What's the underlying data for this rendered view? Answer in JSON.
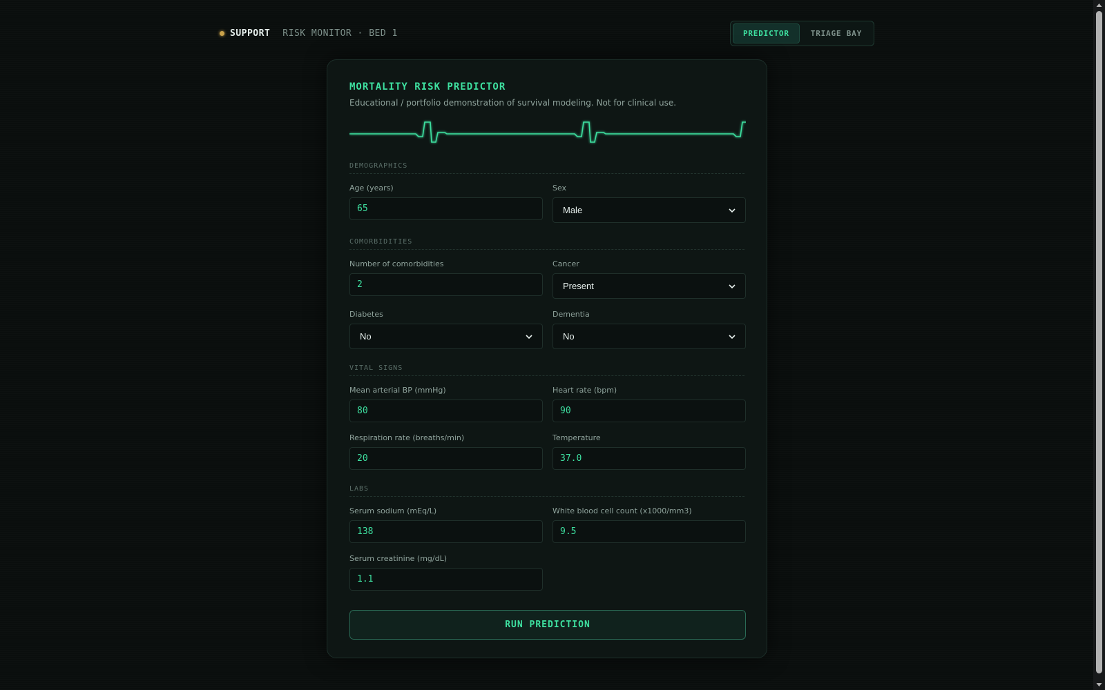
{
  "header": {
    "brand": "SUPPORT",
    "subtitle": "RISK MONITOR · BED 1",
    "tabs": [
      {
        "label": "PREDICTOR",
        "active": true
      },
      {
        "label": "TRIAGE BAY",
        "active": false
      }
    ]
  },
  "card": {
    "title": "MORTALITY RISK PREDICTOR",
    "subtitle": "Educational / portfolio demonstration of survival modeling. Not for clinical use."
  },
  "sections": {
    "demographics": "DEMOGRAPHICS",
    "comorbidities": "COMORBIDITIES",
    "vitals": "VITAL SIGNS",
    "labs": "LABS"
  },
  "fields": {
    "age": {
      "label": "Age (years)",
      "value": "65"
    },
    "sex": {
      "label": "Sex",
      "value": "Male"
    },
    "num_comorbidities": {
      "label": "Number of comorbidities",
      "value": "2"
    },
    "cancer": {
      "label": "Cancer",
      "value": "Present"
    },
    "diabetes": {
      "label": "Diabetes",
      "value": "No"
    },
    "dementia": {
      "label": "Dementia",
      "value": "No"
    },
    "mean_bp": {
      "label": "Mean arterial BP (mmHg)",
      "value": "80"
    },
    "heart_rate": {
      "label": "Heart rate (bpm)",
      "value": "90"
    },
    "resp_rate": {
      "label": "Respiration rate (breaths/min)",
      "value": "20"
    },
    "temperature": {
      "label": "Temperature",
      "value": "37.0"
    },
    "sodium": {
      "label": "Serum sodium (mEq/L)",
      "value": "138"
    },
    "wbc": {
      "label": "White blood cell count (x1000/mm3)",
      "value": "9.5"
    },
    "creatinine": {
      "label": "Serum creatinine (mg/dL)",
      "value": "1.1"
    }
  },
  "actions": {
    "run_label": "RUN PREDICTION"
  },
  "colors": {
    "accent": "#3ee0a0",
    "background": "#0a0e0d",
    "brand_dot": "#c9a24a"
  }
}
